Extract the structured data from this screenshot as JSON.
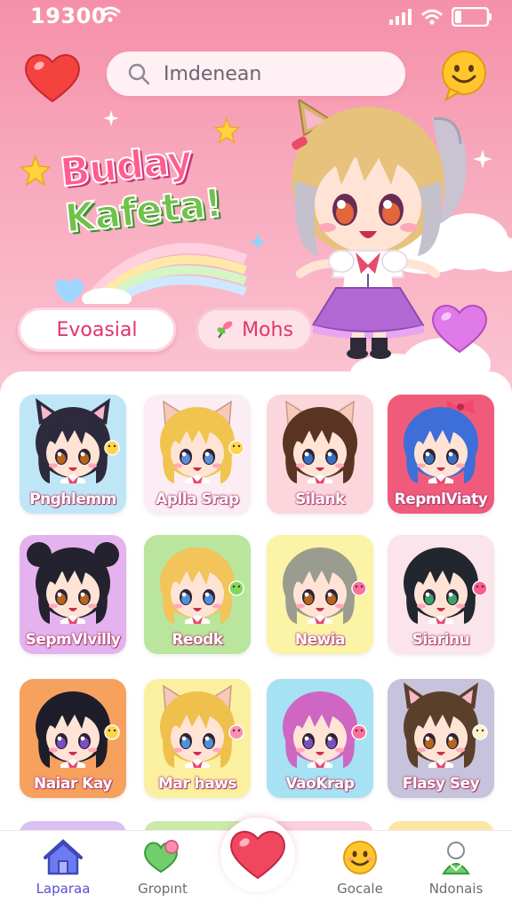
{
  "status_bar": {
    "time": "19300"
  },
  "search": {
    "text": "Imdenean"
  },
  "logo": {
    "line1": "Buday",
    "line2": "Kafeta!"
  },
  "buttons": {
    "primary_label": "Evoasial",
    "secondary_label": "Mohs"
  },
  "characters": [
    {
      "name": "Pnghlemm",
      "bg": "#bfe6f6",
      "hair": "#2d2a3d",
      "eyes": "#b5651d",
      "ears": "cat",
      "deco": "#ffd54a"
    },
    {
      "name": "Aplla Srap",
      "bg": "#fcecf3",
      "hair": "#f0c44e",
      "eyes": "#5b8ed6",
      "ears": "cat-pink",
      "deco": "#ffd54a"
    },
    {
      "name": "Silank",
      "bg": "#fbd6dd",
      "hair": "#5a3422",
      "eyes": "#3a6fc0",
      "ears": "cat-pink",
      "deco": ""
    },
    {
      "name": "RepmlViaty",
      "bg": "#f05b7c",
      "hair": "#3e6ed8",
      "eyes": "#3a6fc0",
      "ears": "bow",
      "deco": ""
    },
    {
      "name": "SepmVlvilly",
      "bg": "#e4b3ef",
      "hair": "#24222e",
      "eyes": "#b5651d",
      "ears": "buns",
      "deco": ""
    },
    {
      "name": "Reodk",
      "bg": "#b9e59c",
      "hair": "#f2c45a",
      "eyes": "#4f91d8",
      "ears": "",
      "deco": "#7ed957"
    },
    {
      "name": "Newia",
      "bg": "#fbf3a6",
      "hair": "#9a9c90",
      "eyes": "#b5651d",
      "ears": "",
      "deco": "#ff6f9a"
    },
    {
      "name": "Siarinu",
      "bg": "#fbe4ea",
      "hair": "#22262e",
      "eyes": "#3aa36a",
      "ears": "",
      "deco": "#ff5d8f"
    },
    {
      "name": "Naiar Kay",
      "bg": "#f7a15f",
      "hair": "#1f1d29",
      "eyes": "#7a4fc0",
      "ears": "",
      "deco": "#ffd54a"
    },
    {
      "name": "Mar haws",
      "bg": "#fbf0a0",
      "hair": "#efc04c",
      "eyes": "#4f91d8",
      "ears": "cat-pink",
      "deco": "#ff8fb1"
    },
    {
      "name": "VaoKrap",
      "bg": "#a6e2f4",
      "hair": "#cf66c2",
      "eyes": "#7a4fc0",
      "ears": "",
      "deco": "#ff6f9a"
    },
    {
      "name": "Flasy Sey",
      "bg": "#c8c3dc",
      "hair": "#5a3f2a",
      "eyes": "#b5651d",
      "ears": "cat",
      "deco": "#fff2c9"
    }
  ],
  "nav": [
    {
      "label": "Laparaa",
      "icon": "house-icon",
      "active": true
    },
    {
      "label": "Gropınt",
      "icon": "heart-balloon-icon",
      "active": false
    },
    {
      "label": "Gocale",
      "icon": "smile-face-icon",
      "active": false
    },
    {
      "label": "Ndonais",
      "icon": "character-icon",
      "active": false
    }
  ],
  "colors": {
    "accent": "#e0356b",
    "hero": "#f590aa",
    "active_nav": "#5a4fcf"
  }
}
